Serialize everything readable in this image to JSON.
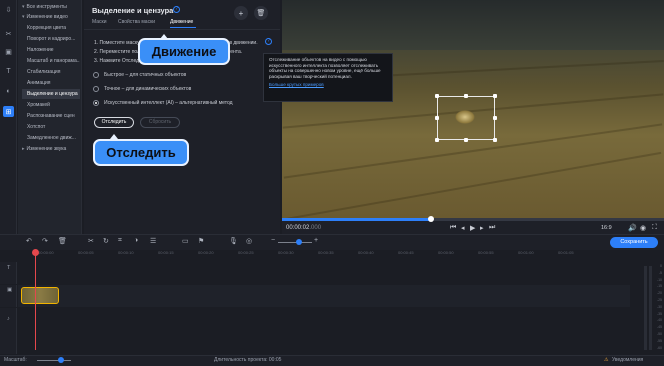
{
  "app": {
    "accent_color": "#2d7ff9"
  },
  "rail": {
    "icons": [
      "import-icon",
      "tools-icon",
      "transitions-icon",
      "text-icon",
      "filters-icon",
      "more-icon",
      "apps-icon"
    ]
  },
  "tools": {
    "all_tools": "Все инструменты",
    "items": [
      "Изменение видео",
      "Коррекция цвета",
      "Поворот и кадриро...",
      "Наложение",
      "Масштаб и панорама...",
      "Стабилизация",
      "Анимация",
      "Выделение и цензура",
      "Хромакей",
      "Распознавание сцен",
      "Хотспот",
      "Замедленное движ...",
      "Изменение звука"
    ],
    "selected_index": 7
  },
  "panel": {
    "title": "Выделение и цензура",
    "tabs": [
      "Маски",
      "Свойства маски",
      "Движение"
    ],
    "active_tab": 2,
    "steps": [
      "1. Поместите маску на объект, за которым нужно следить в движении.",
      "2. Переместите ползунок в начало отслеживаемого фрагмента.",
      "3. Нажмите Отследить"
    ],
    "options": [
      "Быстрое – для статичных объектов",
      "Точное – для динамических объектов",
      "Искусственный интеллект (AI) – альтернативный метод"
    ],
    "selected_option": 2,
    "track_button": "Отследить",
    "reset_button": "Сбросить"
  },
  "callouts": {
    "motion": "Движение",
    "track": "Отследить"
  },
  "tooltip": {
    "text": "Отслеживание объектов на видео с помощью искусственного интеллекта позволяет отслеживать объекты на совершенно новом уровне, ещё больше раскрывая ваш творческий потенциал.",
    "link": "Больше крутых примеров"
  },
  "player": {
    "time_current": "00:00:02",
    "time_frac": "000",
    "aspect": "16:9",
    "progress": 0.39
  },
  "timeline": {
    "save_button": "Сохранить",
    "ticks": [
      "00:00:00",
      "00:00:05",
      "00:00:10",
      "00:00:15",
      "00:00:20",
      "00:00:25",
      "00:00:30",
      "00:00:35",
      "00:00:40",
      "00:00:45",
      "00:00:50",
      "00:00:55",
      "00:01:00",
      "00:01:05"
    ],
    "vu_labels": [
      "0",
      "-5",
      "-10",
      "-15",
      "-20",
      "-25",
      "-30",
      "-35",
      "-40",
      "-45",
      "-50",
      "-55",
      "-60"
    ]
  },
  "status": {
    "scale_label": "Масштаб:",
    "duration_label": "Длительность проекта:",
    "duration_value": "00:05",
    "notifications": "Уведомления"
  }
}
